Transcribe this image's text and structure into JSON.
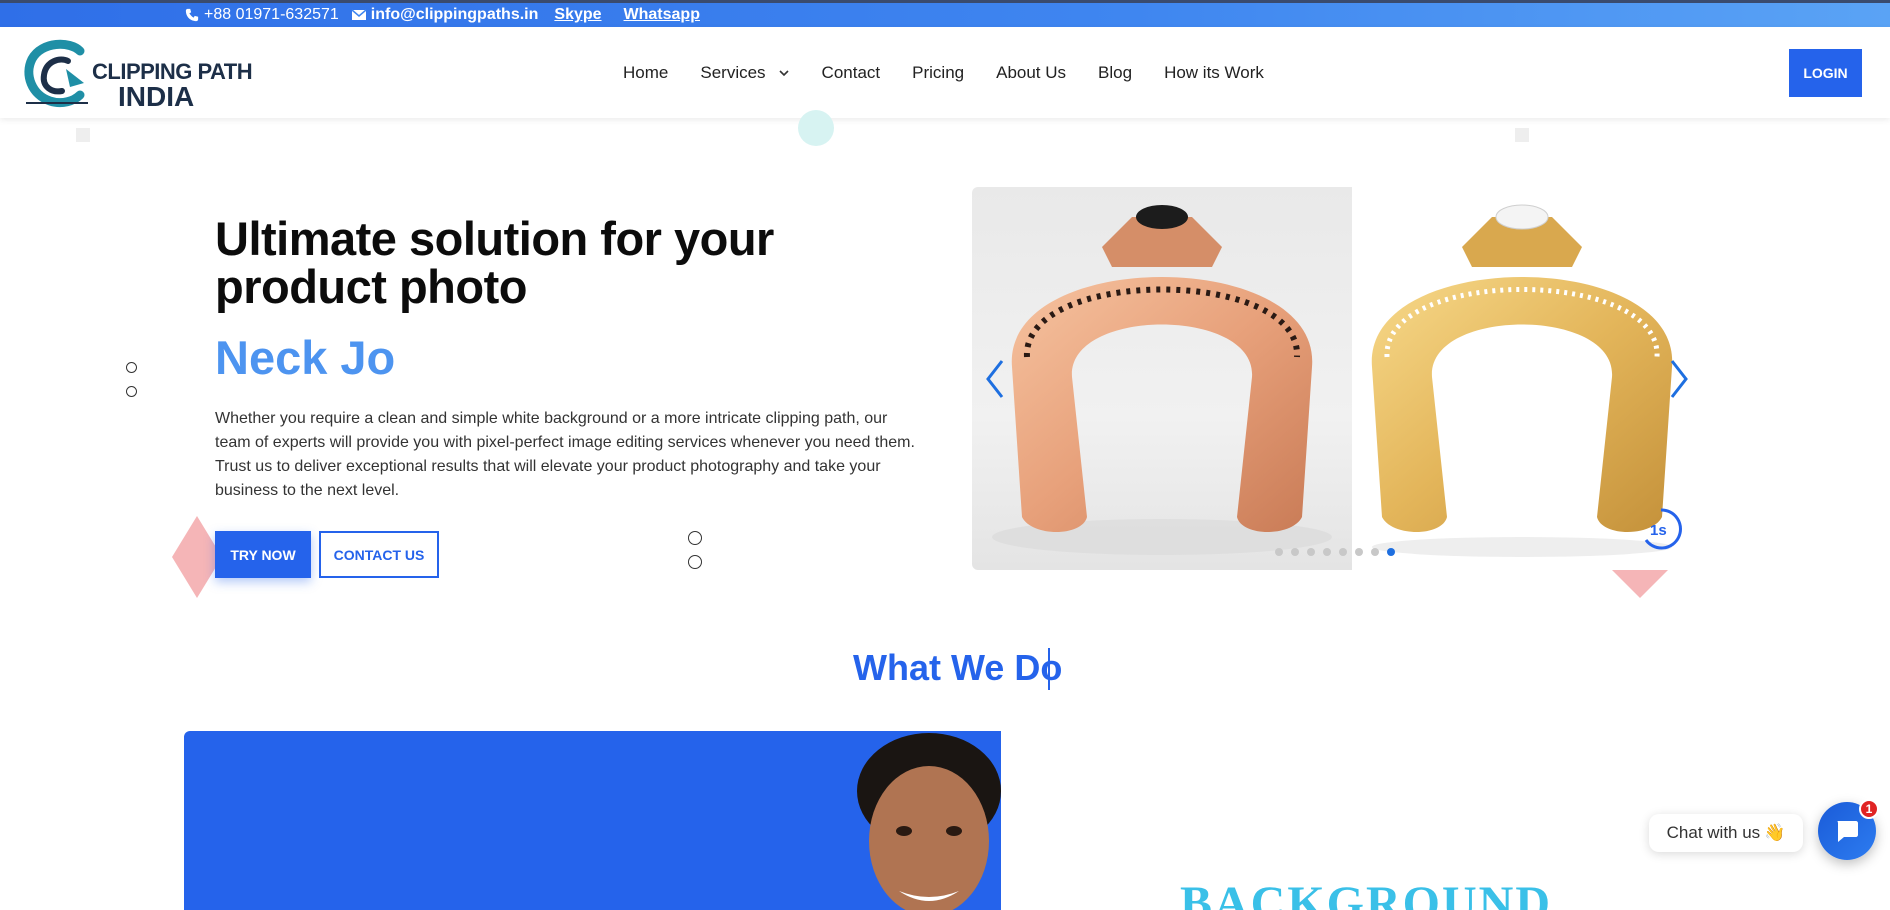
{
  "topbar": {
    "phone": "+88 01971-632571",
    "email": "info@clippingpaths.in",
    "skype": "Skype",
    "whatsapp": "Whatsapp"
  },
  "logo": {
    "line1": "CLIPPING PATH",
    "line2": "INDIA"
  },
  "nav": {
    "items": [
      "Home",
      "Services",
      "Contact",
      "Pricing",
      "About Us",
      "Blog",
      "How its Work"
    ],
    "login": "LOGIN"
  },
  "hero": {
    "title": "Ultimate solution for your product photo",
    "typed": "Neck Jo",
    "description": "Whether you require a clean and simple white background or a more intricate clipping path, our team of experts will provide you with pixel-perfect image editing services whenever you need them. Trust us to deliver exceptional results that will elevate your product photography and take your business to the next level.",
    "try_now": "TRY NOW",
    "contact_us": "CONTACT US"
  },
  "slider": {
    "total_dots": 8,
    "active_dot": 8,
    "timer": "1s"
  },
  "section": {
    "title": "What We Do",
    "background_word": "BACKGROUND"
  },
  "chat": {
    "label": "Chat with us",
    "emoji": "👋",
    "badge": "1"
  },
  "colors": {
    "primary": "#2563eb",
    "typed": "#4d94f0",
    "accent_pink": "#f5b5b7",
    "background_word": "#3ac0e8"
  }
}
